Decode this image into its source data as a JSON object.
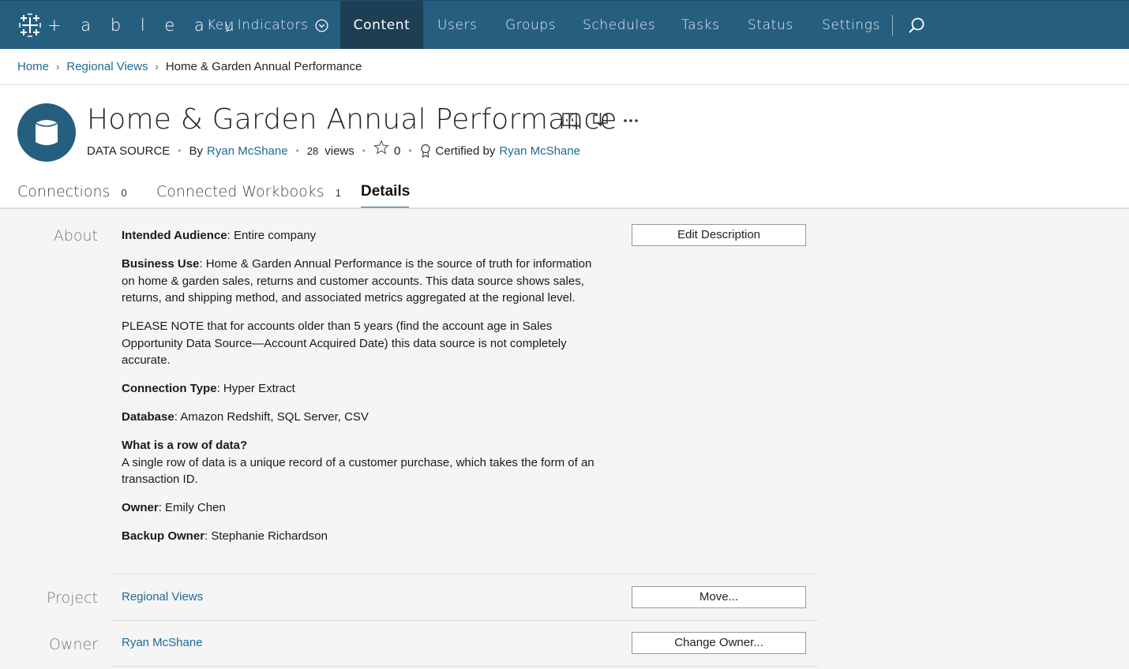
{
  "nav": {
    "logo_text": "+ a b l e a u",
    "key_indicators": "Key Indicators",
    "items": [
      "Content",
      "Users",
      "Groups",
      "Schedules",
      "Tasks",
      "Status",
      "Settings"
    ],
    "active": "Content"
  },
  "breadcrumb": {
    "home": "Home",
    "parent": "Regional Views",
    "current": "Home & Garden Annual Performance"
  },
  "header": {
    "title": "Home & Garden Annual Performance",
    "type": "DATA SOURCE",
    "by_label": "By",
    "author": "Ryan McShane",
    "views_count": "28",
    "views_label": "views",
    "favorites": "0",
    "certified_label": "Certified by",
    "certified_by": "Ryan McShane"
  },
  "tabs": [
    {
      "label": "Connections",
      "count": "0"
    },
    {
      "label": "Connected Workbooks",
      "count": "1"
    },
    {
      "label": "Details",
      "count": ""
    }
  ],
  "details": {
    "about_label": "About",
    "about": {
      "audience_key": "Intended Audience",
      "audience_val": ": Entire company",
      "business_key": "Business Use",
      "business_val": ": Home & Garden Annual Performance is the source of truth for information on home & garden sales, returns and customer accounts. This data source shows sales, returns, and shipping method, and associated metrics aggregated at the regional level.",
      "note": "PLEASE NOTE that for accounts older than 5 years (find the account age in Sales Opportunity Data Source—Account Acquired Date) this data source is not completely accurate.",
      "conn_key": "Connection Type",
      "conn_val": ": Hyper Extract",
      "db_key": "Database",
      "db_val": ": Amazon Redshift, SQL Server, CSV",
      "row_key": "What is a row of data?",
      "row_val": "A single row of data is a unique record of a customer purchase, which takes the form of an transaction ID.",
      "owner_key": "Owner",
      "owner_val": ": Emily Chen",
      "backup_key": "Backup Owner",
      "backup_val": ": Stephanie Richardson"
    },
    "edit_description": "Edit Description",
    "project_label": "Project",
    "project_value": "Regional Views",
    "move_button": "Move...",
    "owner_label": "Owner",
    "owner_value": "Ryan McShane",
    "change_owner_button": "Change Owner..."
  },
  "colors": {
    "nav_bg": "#265e80",
    "nav_active": "#1e3e54",
    "link": "#1f6a94"
  }
}
